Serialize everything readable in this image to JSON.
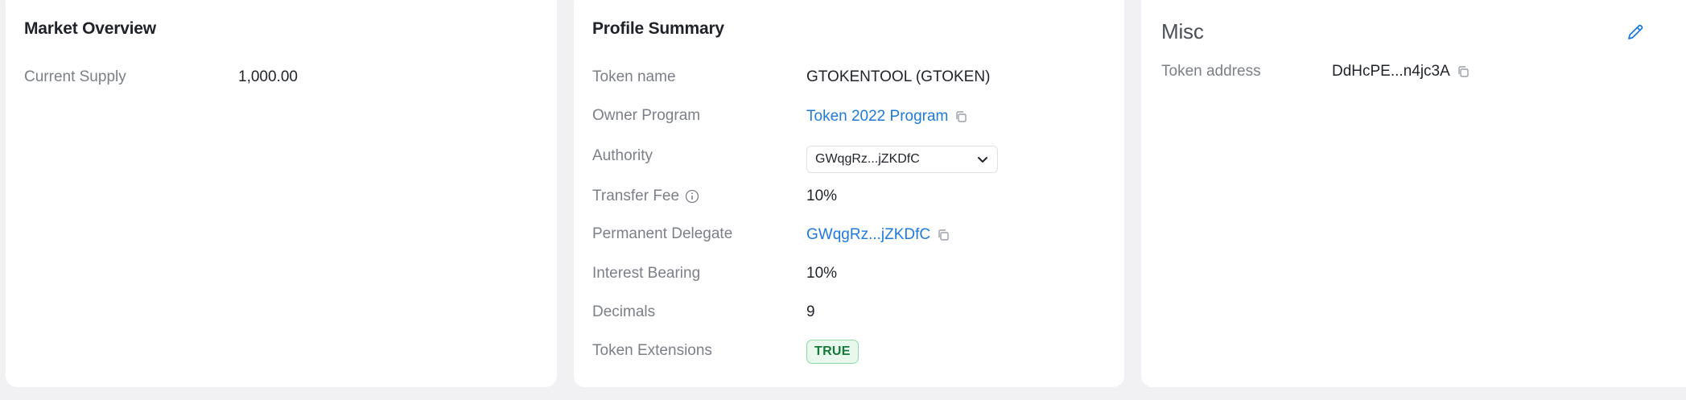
{
  "market": {
    "title": "Market Overview",
    "current_supply_label": "Current Supply",
    "current_supply_value": "1,000.00"
  },
  "profile": {
    "title": "Profile Summary",
    "token_name_label": "Token name",
    "token_name_value": "GTOKENTOOL (GTOKEN)",
    "owner_program_label": "Owner Program",
    "owner_program_value": "Token 2022 Program",
    "authority_label": "Authority",
    "authority_value": "GWqgRz...jZKDfC",
    "transfer_fee_label": "Transfer Fee",
    "transfer_fee_value": "10%",
    "permanent_delegate_label": "Permanent Delegate",
    "permanent_delegate_value": "GWqgRz...jZKDfC",
    "interest_bearing_label": "Interest Bearing",
    "interest_bearing_value": "10%",
    "decimals_label": "Decimals",
    "decimals_value": "9",
    "token_extensions_label": "Token Extensions",
    "token_extensions_value": "TRUE"
  },
  "misc": {
    "title": "Misc",
    "token_address_label": "Token address",
    "token_address_value": "DdHcPE...n4jc3A"
  },
  "colors": {
    "link": "#1f7ae0",
    "badge_bg": "#e8f8ec",
    "badge_border": "#8fd8a5",
    "badge_text": "#137a3a"
  },
  "icons": [
    "copy-icon",
    "info-icon",
    "chevron-down-icon",
    "pencil-icon"
  ]
}
